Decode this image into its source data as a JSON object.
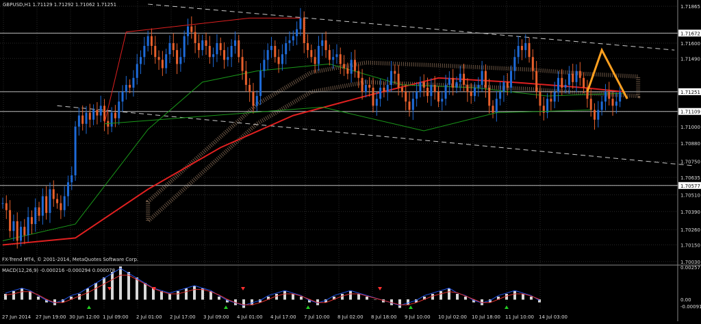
{
  "header": {
    "symbol_text": "GBPUSD,H1  1.71129 1.71292 1.71062 1.71251"
  },
  "copyright": "FX-Trend MT4, © 2001-2014, MetaQuotes Software Corp.",
  "macd": {
    "label": "MACD(12,26,9) -0.000216 -0.000294 0.000078",
    "axis_labels": [
      "0.002571",
      "0.00",
      "-0.000915"
    ]
  },
  "colors": {
    "background": "#000000",
    "grid": "#2a2a2a",
    "bull_candle": "#1e6bd9",
    "bear_candle": "#e8602c",
    "ma_slow": "#e02020",
    "ma_fast": "#1a9a1a",
    "cloud": "#c8a080",
    "trend_channel": "#cccccc",
    "projection": "#ffa020",
    "macd_hist": "#d8d8d8",
    "macd_line": "#2255ee",
    "macd_signal": "#e03030",
    "arrow_up": "#22cc22",
    "arrow_down": "#ff3030"
  },
  "chart_data": {
    "type": "candlestick",
    "symbol": "GBPUSD",
    "timeframe": "H1",
    "last_bar": {
      "open": 1.71129,
      "high": 1.71292,
      "low": 1.71062,
      "close": 1.71251
    },
    "ylim": [
      1.7001,
      1.719
    ],
    "y_ticks": [
      1.71865,
      1.71672,
      1.716,
      1.7149,
      1.71251,
      1.71109,
      1.71,
      1.7088,
      1.7075,
      1.70635,
      1.70577,
      1.7051,
      1.7039,
      1.7026,
      1.7015,
      1.7003
    ],
    "highlight_levels": [
      1.71672,
      1.71251,
      1.71109,
      1.70577
    ],
    "x_ticks": [
      "27 Jun 2014",
      "27 Jun 19:00",
      "30 Jun 12:00",
      "1 Jul 09:00",
      "2 Jul 01:00",
      "2 Jul 17:00",
      "3 Jul 09:00",
      "4 Jul 01:00",
      "4 Jul 17:00",
      "7 Jul 10:00",
      "8 Jul 02:00",
      "8 Jul 18:00",
      "9 Jul 10:00",
      "10 Jul 02:00",
      "10 Jul 18:00",
      "11 Jul 10:00",
      "14 Jul 03:00"
    ],
    "closes": [
      1.7045,
      1.704,
      1.7025,
      1.7032,
      1.7018,
      1.7028,
      1.7022,
      1.7035,
      1.703,
      1.7042,
      1.7036,
      1.705,
      1.7038,
      1.7055,
      1.7048,
      1.7045,
      1.704,
      1.705,
      1.706,
      1.7065,
      1.71,
      1.7108,
      1.7102,
      1.711,
      1.7105,
      1.7112,
      1.7108,
      1.7115,
      1.7104,
      1.71,
      1.711,
      1.7106,
      1.7118,
      1.7125,
      1.713,
      1.7128,
      1.7135,
      1.7145,
      1.715,
      1.7158,
      1.7165,
      1.7158,
      1.715,
      1.7148,
      1.7142,
      1.7152,
      1.716,
      1.7155,
      1.7145,
      1.715,
      1.7165,
      1.7172,
      1.7168,
      1.716,
      1.7155,
      1.7162,
      1.7158,
      1.715,
      1.7152,
      1.716,
      1.7155,
      1.7148,
      1.715,
      1.7158,
      1.7162,
      1.715,
      1.714,
      1.713,
      1.7125,
      1.7115,
      1.7122,
      1.714,
      1.7148,
      1.7155,
      1.7158,
      1.715,
      1.7145,
      1.7152,
      1.716,
      1.7162,
      1.7165,
      1.717,
      1.7178,
      1.716,
      1.7155,
      1.715,
      1.7145,
      1.7158,
      1.7162,
      1.7155,
      1.7148,
      1.715,
      1.7152,
      1.7145,
      1.7142,
      1.7138,
      1.7148,
      1.714,
      1.7135,
      1.7125,
      1.713,
      1.7128,
      1.7115,
      1.712,
      1.7128,
      1.7125,
      1.713,
      1.714,
      1.7138,
      1.7128,
      1.7125,
      1.7118,
      1.7112,
      1.712,
      1.7125,
      1.7132,
      1.7128,
      1.7122,
      1.713,
      1.7125,
      1.7118,
      1.712,
      1.713,
      1.7135,
      1.7128,
      1.7132,
      1.7138,
      1.713,
      1.7125,
      1.7122,
      1.7128,
      1.713,
      1.714,
      1.7128,
      1.7115,
      1.711,
      1.712,
      1.7125,
      1.7132,
      1.7128,
      1.714,
      1.715,
      1.7158,
      1.7155,
      1.716,
      1.715,
      1.714,
      1.7125,
      1.7115,
      1.711,
      1.712,
      1.7118,
      1.7125,
      1.7135,
      1.7128,
      1.713,
      1.7138,
      1.7132,
      1.714,
      1.7135,
      1.7128,
      1.712,
      1.7112,
      1.7105,
      1.7112,
      1.7118,
      1.7125,
      1.712,
      1.7115,
      1.7118,
      1.7125
    ],
    "ma_slow_points": [
      [
        0,
        1.7015
      ],
      [
        20,
        1.702
      ],
      [
        40,
        1.7055
      ],
      [
        60,
        1.7085
      ],
      [
        80,
        1.7108
      ],
      [
        100,
        1.7122
      ],
      [
        120,
        1.7135
      ],
      [
        140,
        1.7132
      ],
      [
        160,
        1.7128
      ],
      [
        171,
        1.7125
      ]
    ],
    "ma_fast_points": [
      [
        0,
        1.7018
      ],
      [
        20,
        1.703
      ],
      [
        40,
        1.7098
      ],
      [
        55,
        1.7132
      ],
      [
        70,
        1.714
      ],
      [
        90,
        1.7145
      ],
      [
        110,
        1.713
      ],
      [
        130,
        1.7128
      ],
      [
        150,
        1.7122
      ],
      [
        171,
        1.7124
      ]
    ],
    "channel_upper": [
      [
        40,
        1.7188
      ],
      [
        185,
        1.7155
      ]
    ],
    "channel_lower": [
      [
        15,
        1.7115
      ],
      [
        190,
        1.7072
      ]
    ],
    "zigzag_red": [
      [
        28,
        1.7102
      ],
      [
        34,
        1.7168
      ],
      [
        68,
        1.7178
      ],
      [
        82,
        1.7178
      ]
    ],
    "zigzag_green": [
      [
        28,
        1.7102
      ],
      [
        88,
        1.7114
      ],
      [
        116,
        1.7097
      ],
      [
        136,
        1.711
      ],
      [
        162,
        1.7112
      ]
    ],
    "projection": [
      [
        161,
        1.7125
      ],
      [
        165,
        1.7155
      ],
      [
        172,
        1.712
      ]
    ],
    "cloud_points": [
      [
        40,
        1.704
      ],
      [
        55,
        1.7075
      ],
      [
        70,
        1.711
      ],
      [
        85,
        1.7133
      ],
      [
        100,
        1.714
      ],
      [
        120,
        1.7138
      ],
      [
        145,
        1.7135
      ],
      [
        160,
        1.7132
      ],
      [
        175,
        1.713
      ]
    ],
    "macd_hist": [
      0.0002,
      0.0003,
      0.0004,
      0.0003,
      0.0001,
      -0.0001,
      -0.0002,
      -0.0001,
      0.0001,
      0.0002,
      0.0004,
      0.0006,
      0.0008,
      0.001,
      0.0012,
      0.001,
      0.0008,
      0.0006,
      0.0004,
      0.0003,
      0.0002,
      0.0003,
      0.0004,
      0.0005,
      0.0004,
      0.0003,
      0.0001,
      -0.0001,
      -0.0002,
      -0.0003,
      -0.0002,
      -0.0001,
      0.0001,
      0.0002,
      0.0003,
      0.0002,
      0.0001,
      -0.0001,
      -0.0002,
      -0.0001,
      0.0001,
      0.0002,
      0.0003,
      0.0002,
      0.0001,
      0.0,
      -0.0001,
      -0.0002,
      -0.0003,
      -0.0002,
      -0.0001,
      0.0001,
      0.0002,
      0.0003,
      0.0004,
      0.0002,
      0.0001,
      -0.0001,
      -0.0002,
      -0.0001,
      0.0001,
      0.0002,
      0.0003,
      0.0002,
      0.0001,
      -0.0001
    ]
  }
}
